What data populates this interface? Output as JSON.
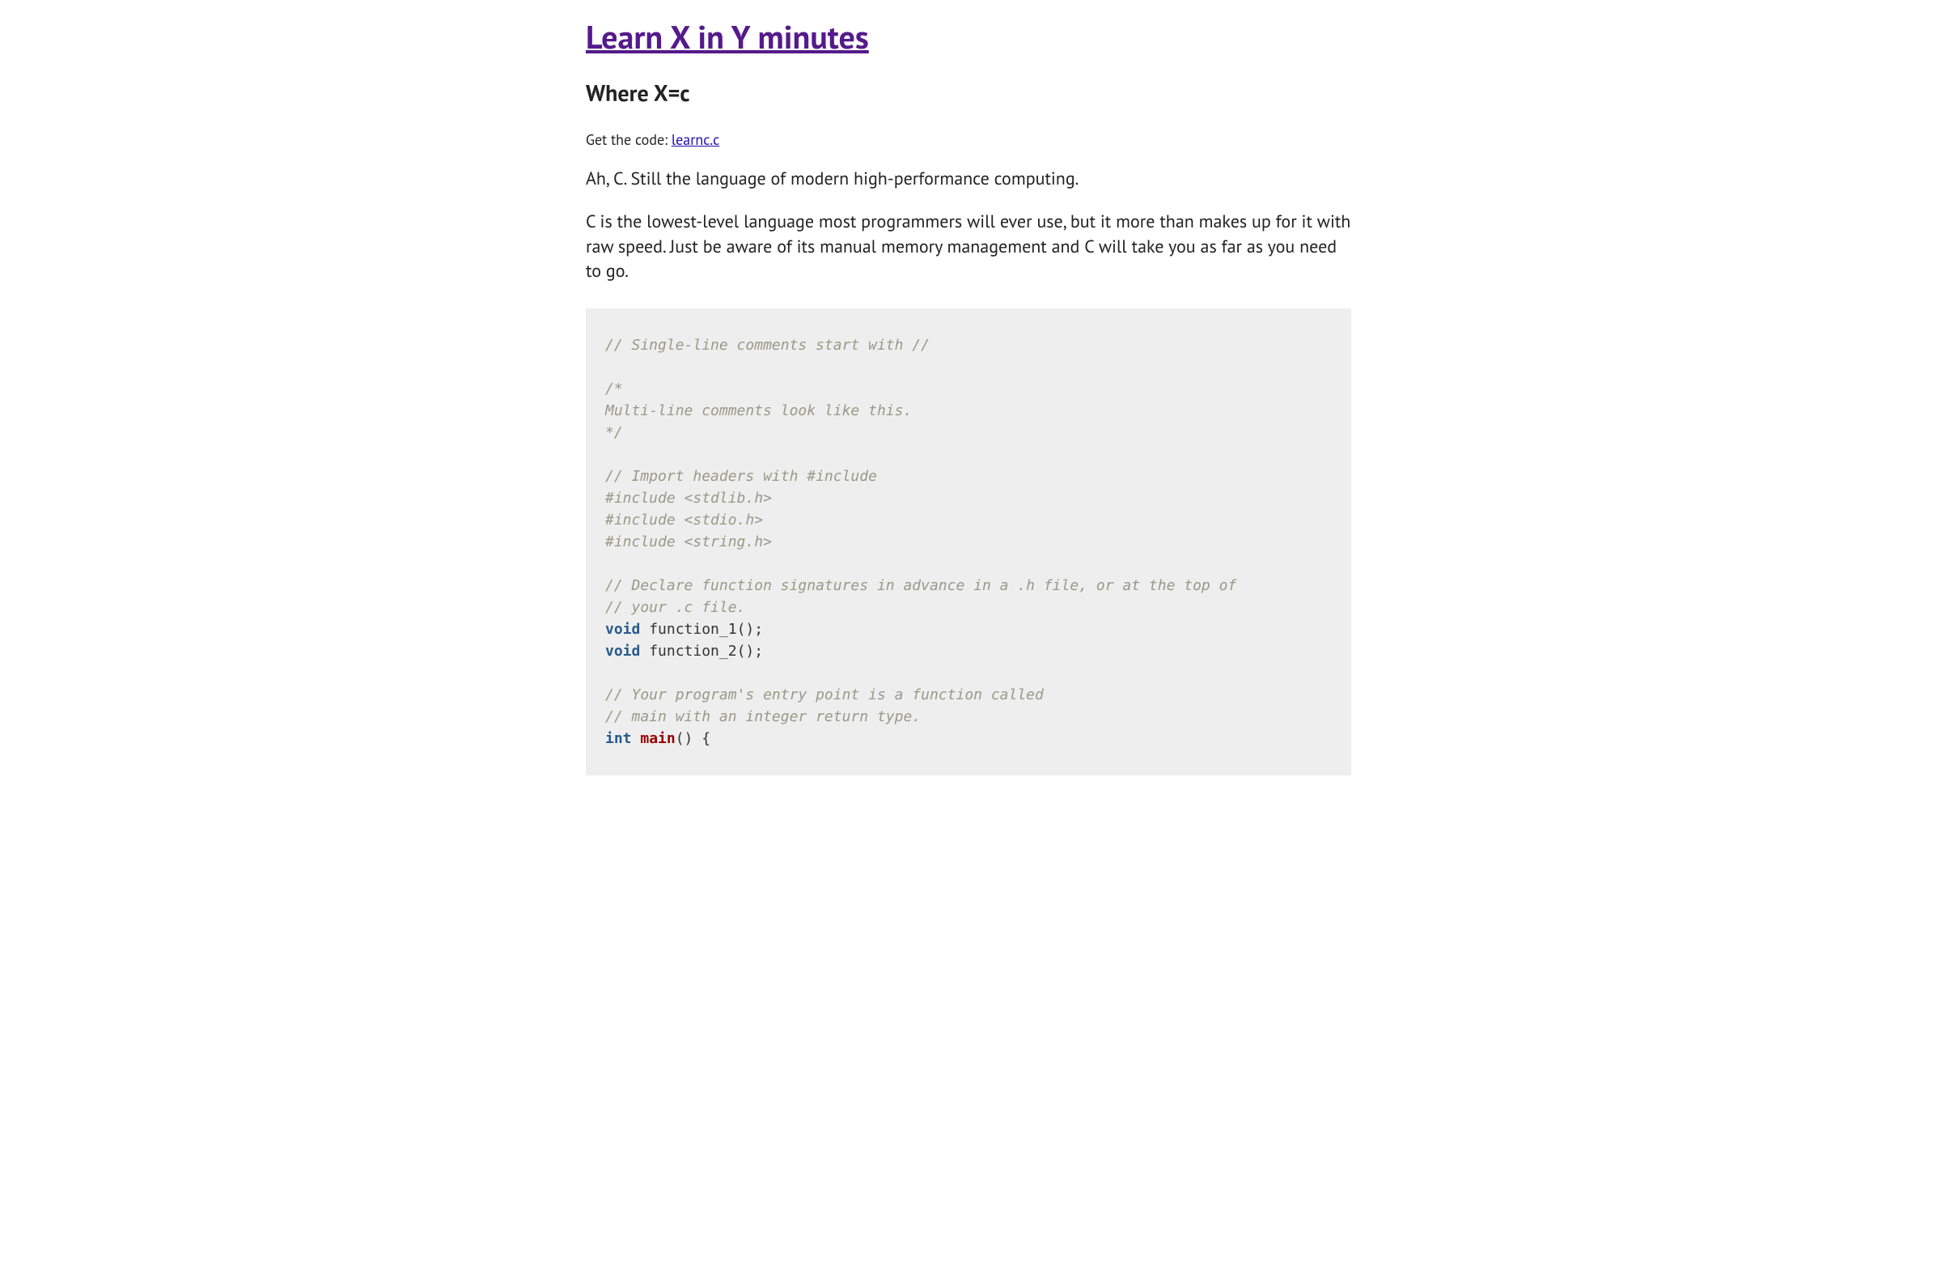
{
  "header": {
    "title": "Learn X in Y minutes",
    "subtitle": "Where X=c"
  },
  "getcode": {
    "label": "Get the code: ",
    "link_text": "learnc.c"
  },
  "intro": {
    "p1": "Ah, C. Still the language of modern high-performance computing.",
    "p2": "C is the lowest-level language most programmers will ever use, but it more than makes up for it with raw speed. Just be aware of its manual memory management and C will take you as far as you need to go."
  },
  "code": {
    "tokens": [
      {
        "cls": "c-comment",
        "text": "// Single-line comments start with //"
      },
      {
        "cls": "",
        "text": "\n\n"
      },
      {
        "cls": "c-comment",
        "text": "/*\nMulti-line comments look like this.\n*/"
      },
      {
        "cls": "",
        "text": "\n\n"
      },
      {
        "cls": "c-comment",
        "text": "// Import headers with #include"
      },
      {
        "cls": "",
        "text": "\n"
      },
      {
        "cls": "c-preproc",
        "text": "#include <stdlib.h>"
      },
      {
        "cls": "",
        "text": "\n"
      },
      {
        "cls": "c-preproc",
        "text": "#include <stdio.h>"
      },
      {
        "cls": "",
        "text": "\n"
      },
      {
        "cls": "c-preproc",
        "text": "#include <string.h>"
      },
      {
        "cls": "",
        "text": "\n\n"
      },
      {
        "cls": "c-comment",
        "text": "// Declare function signatures in advance in a .h file, or at the top of"
      },
      {
        "cls": "",
        "text": "\n"
      },
      {
        "cls": "c-comment",
        "text": "// your .c file."
      },
      {
        "cls": "",
        "text": "\n"
      },
      {
        "cls": "c-keyword",
        "text": "void"
      },
      {
        "cls": "c-plain",
        "text": " function_1();"
      },
      {
        "cls": "",
        "text": "\n"
      },
      {
        "cls": "c-keyword",
        "text": "void"
      },
      {
        "cls": "c-plain",
        "text": " function_2();"
      },
      {
        "cls": "",
        "text": "\n\n"
      },
      {
        "cls": "c-comment",
        "text": "// Your program's entry point is a function called"
      },
      {
        "cls": "",
        "text": "\n"
      },
      {
        "cls": "c-comment",
        "text": "// main with an integer return type."
      },
      {
        "cls": "",
        "text": "\n"
      },
      {
        "cls": "c-keyword",
        "text": "int"
      },
      {
        "cls": "c-plain",
        "text": " "
      },
      {
        "cls": "c-funcname",
        "text": "main"
      },
      {
        "cls": "c-plain",
        "text": "() {"
      }
    ]
  }
}
